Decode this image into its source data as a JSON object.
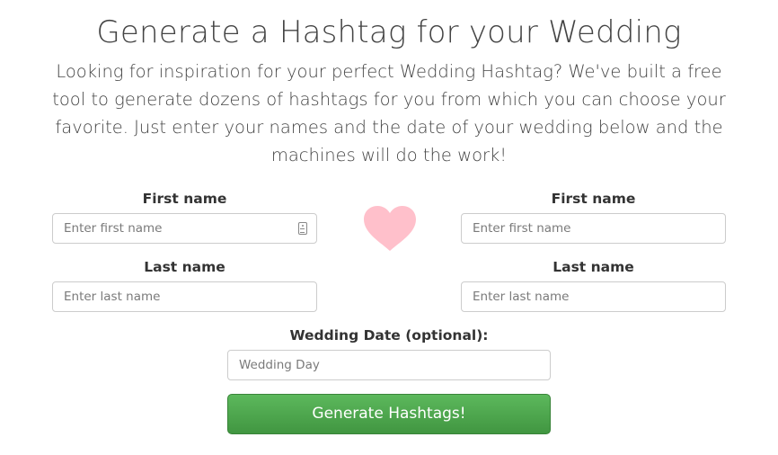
{
  "header": {
    "title": "Generate a Hashtag for your Wedding",
    "intro": "Looking for inspiration for your perfect Wedding Hashtag? We've built a free tool to generate dozens of hashtags for you from which you can choose your favorite. Just enter your names and the date of your wedding below and the machines will do the work!"
  },
  "form": {
    "partner1": {
      "first_name_label": "First name",
      "first_name_placeholder": "Enter first name",
      "first_name_value": "",
      "last_name_label": "Last name",
      "last_name_placeholder": "Enter last name",
      "last_name_value": ""
    },
    "partner2": {
      "first_name_label": "First name",
      "first_name_placeholder": "Enter first name",
      "first_name_value": "",
      "last_name_label": "Last name",
      "last_name_placeholder": "Enter last name",
      "last_name_value": ""
    },
    "date": {
      "label": "Wedding Date (optional):",
      "placeholder": "Wedding Day",
      "value": ""
    },
    "submit_label": "Generate Hashtags!"
  },
  "icons": {
    "divider": "heart-icon",
    "autofill": "contact-card-icon"
  },
  "colors": {
    "heart": "#ffc0cb",
    "button": "#4cae4c",
    "button_text": "#ffffff"
  }
}
